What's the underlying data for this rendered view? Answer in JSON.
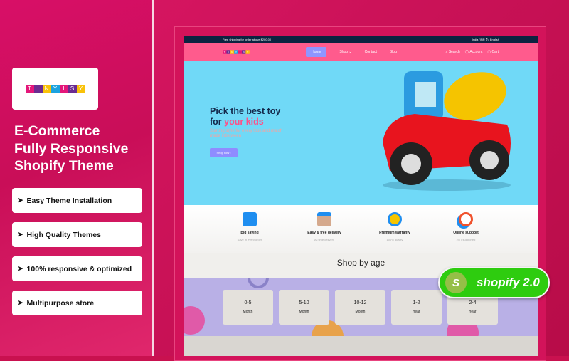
{
  "promo": {
    "logo_text": "TINYISY",
    "logo_letters": [
      "T",
      "I",
      "N",
      "Y",
      "I",
      "S",
      "Y"
    ],
    "logo_colors": [
      "#e4177a",
      "#6b2c91",
      "#f9c20a",
      "#1ba3e0",
      "#e4177a",
      "#6b2c91",
      "#f9c20a"
    ],
    "headline": [
      "E-Commerce",
      "Fully Responsive",
      "Shopify Theme"
    ],
    "features": [
      "Easy Theme Installation",
      "High Quality Themes",
      "100% responsive & optimized",
      "Multipurpose store"
    ],
    "shopify_badge": "shopify 2.0"
  },
  "site": {
    "topbar": {
      "shipping": "Free shipping for order above $200.00",
      "currency": "India (INR ₹)",
      "language": "English"
    },
    "nav": {
      "links": [
        "Home",
        "Shop ⌄",
        "Contact",
        "Blog"
      ],
      "search": "Search",
      "account": "Account",
      "cart": "Cart"
    },
    "hero": {
      "title_line1": "Pick the best toy",
      "title_line2_prefix": "for ",
      "title_highlight": "your kids",
      "subtitle": "Starting style for every look and match made inbetween",
      "button": "Shop now !"
    },
    "features": [
      {
        "title": "Big saving",
        "sub": "Save in every order",
        "icon": "wallet-icon"
      },
      {
        "title": "Easy & free delivery",
        "sub": "All time delivery",
        "icon": "delivery-person-icon"
      },
      {
        "title": "Premium warranty",
        "sub": "100% quality",
        "icon": "award-ribbon-icon"
      },
      {
        "title": "Online support",
        "sub": "24/7 supported",
        "icon": "support-24-icon"
      }
    ],
    "shop_by_age": {
      "title": "Shop by age",
      "cards": [
        {
          "range": "0-5",
          "unit": "Month"
        },
        {
          "range": "5-10",
          "unit": "Month"
        },
        {
          "range": "10-12",
          "unit": "Month"
        },
        {
          "range": "1-2",
          "unit": "Year"
        },
        {
          "range": "2-4",
          "unit": "Year"
        }
      ]
    }
  },
  "colors": {
    "brand_pink": "#ff5b8d",
    "navy": "#0c2340",
    "hero_blue": "#70d9f7",
    "button_purple": "#8f8cff",
    "shopify_green": "#2ecc0f"
  }
}
